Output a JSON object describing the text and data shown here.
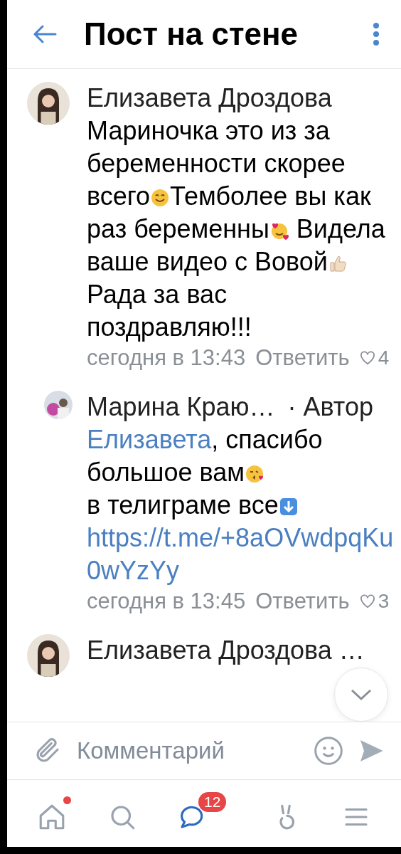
{
  "header": {
    "title": "Пост на стене"
  },
  "comments": [
    {
      "author": "Елизавета Дроздова",
      "reply_level": false,
      "paragraphs": [
        [
          {
            "kind": "text",
            "text": "Мариночка это из за беременности скорее всего"
          },
          {
            "kind": "smile"
          },
          {
            "kind": "text",
            "text": "Темболее вы как раз беременны"
          },
          {
            "kind": "hearts"
          },
          {
            "kind": "text",
            "text": " Видела ваше видео с Вовой"
          },
          {
            "kind": "thumb"
          }
        ],
        [
          {
            "kind": "text",
            "text": "Рада за вас поздравляю!!!"
          }
        ]
      ],
      "time": "сегодня в 13:43",
      "reply": "Ответить",
      "likes": "4"
    },
    {
      "author": "Марина Краю…",
      "reply_level": true,
      "badge": "· Автор",
      "paragraphs": [
        [
          {
            "kind": "mention",
            "text": "Елизавета"
          },
          {
            "kind": "text",
            "text": ", спасибо большое вам"
          },
          {
            "kind": "kiss"
          }
        ],
        [
          {
            "kind": "text",
            "text": "в телиграме все"
          },
          {
            "kind": "arrow"
          }
        ],
        [
          {
            "kind": "link",
            "text": "https://t.me/+8aOVwdpqKu0wYzYy"
          }
        ]
      ],
      "time": "сегодня в 13:45",
      "reply": "Ответить",
      "likes": "3"
    },
    {
      "author": "Елизавета Дроздова …",
      "reply_level": false
    }
  ],
  "composer": {
    "placeholder": "Комментарий"
  },
  "nav": [
    {
      "kind": "home",
      "selected": false,
      "dot": true
    },
    {
      "kind": "search",
      "selected": false,
      "dot": false
    },
    {
      "kind": "messages",
      "selected": true,
      "dot": false,
      "badge": "12"
    },
    {
      "kind": "clips",
      "selected": false,
      "dot": false
    },
    {
      "kind": "menu",
      "selected": false,
      "dot": false
    }
  ]
}
